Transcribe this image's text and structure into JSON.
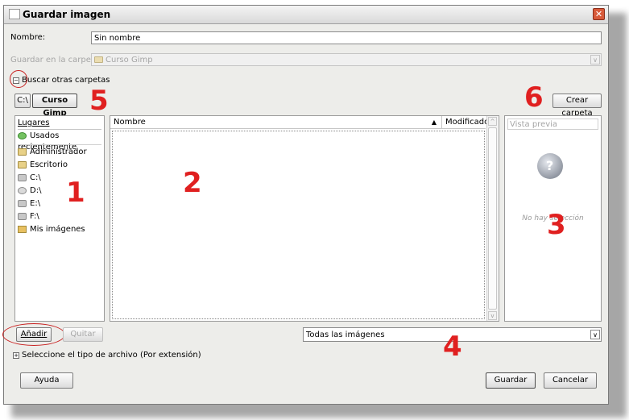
{
  "window": {
    "title": "Guardar imagen"
  },
  "name_row": {
    "label": "Nombre:",
    "value": "Sin nombre"
  },
  "folder_row": {
    "label": "Guardar en la carpeta:",
    "value": "Curso Gimp"
  },
  "browse_toggle": {
    "label": "Buscar otras carpetas"
  },
  "path_bar": {
    "items": [
      "C:\\",
      "Curso Gimp"
    ]
  },
  "create_folder": {
    "label": "Crear carpeta"
  },
  "places": {
    "header": "Lugares",
    "items": [
      {
        "label": "Usados recientemente",
        "icon": "recent-icon"
      },
      {
        "label": "Administrador",
        "icon": "folder-icon"
      },
      {
        "label": "Escritorio",
        "icon": "folder-icon"
      },
      {
        "label": "C:\\",
        "icon": "drive-icon"
      },
      {
        "label": "D:\\",
        "icon": "cdrom-icon"
      },
      {
        "label": "E:\\",
        "icon": "drive-icon"
      },
      {
        "label": "F:\\",
        "icon": "drive-icon"
      },
      {
        "label": "Mis imágenes",
        "icon": "pictures-icon"
      }
    ]
  },
  "files": {
    "col_name": "Nombre",
    "col_modified": "Modificado"
  },
  "preview": {
    "header": "Vista previa",
    "empty_text": "No hay selección"
  },
  "buttons": {
    "add": "Añadir",
    "remove": "Quitar",
    "help": "Ayuda",
    "save": "Guardar",
    "cancel": "Cancelar"
  },
  "filter": {
    "value": "Todas las imágenes"
  },
  "file_type_toggle": {
    "label": "Seleccione el tipo de archivo (Por extensión)"
  },
  "annotations": {
    "color": "#e02020",
    "numbers": [
      "1",
      "2",
      "3",
      "4",
      "5",
      "6"
    ]
  }
}
